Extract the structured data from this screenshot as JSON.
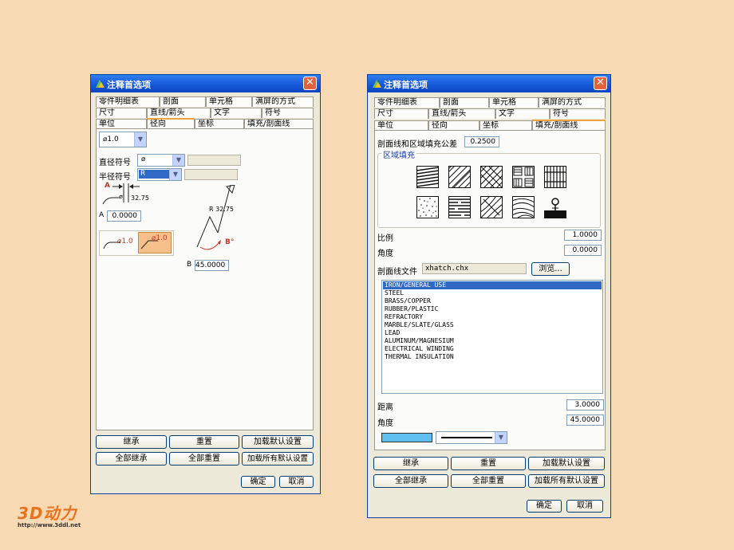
{
  "dialog_title": "注释首选项",
  "left": {
    "tabs_row1": [
      "零件明细表",
      "剖面",
      "单元格",
      "满屏的方式"
    ],
    "tabs_row2": [
      "尺寸",
      "直线/箭头",
      "文字",
      "符号"
    ],
    "tabs_row3": [
      "单位",
      "径向",
      "坐标",
      "填充/剖面线"
    ],
    "active_tab": "径向",
    "format_combo": "⌀1.0",
    "diameter_label": "直径符号",
    "diameter_value": "⌀",
    "radius_label": "半径符号",
    "radius_value": "R",
    "diag_a": "A",
    "diag_dia": "⌀",
    "diag_dim": "32.75",
    "diag_r_dim": "R 32.75",
    "diag_b": "B°",
    "a_label": "A",
    "a_value": "0.0000",
    "style1": "⌀1.0",
    "style2": "⌀1.0",
    "b_label": "B",
    "b_value": "45.0000",
    "btn_inherit": "继承",
    "btn_reset": "重置",
    "btn_load_default": "加载默认设置",
    "btn_inherit_all": "全部继承",
    "btn_reset_all": "全部重置",
    "btn_load_all_default": "加载所有默认设置",
    "btn_ok": "确定",
    "btn_cancel": "取消"
  },
  "right": {
    "tabs_row1": [
      "零件明细表",
      "剖面",
      "单元格",
      "满屏的方式"
    ],
    "tabs_row2": [
      "尺寸",
      "直线/箭头",
      "文字",
      "符号"
    ],
    "tabs_row3": [
      "单位",
      "径向",
      "坐标",
      "填充/剖面线"
    ],
    "active_tab": "填充/剖面线",
    "tolerance_label": "剖面线和区域填充公差",
    "tolerance_value": "0.2500",
    "group_label": "区域填充",
    "scale_label": "比例",
    "scale_value": "1.0000",
    "angle_label": "角度",
    "angle_value": "0.0000",
    "file_label": "剖面线文件",
    "file_value": "xhatch.chx",
    "browse": "浏览...",
    "materials": [
      "IRON/GENERAL USE",
      "STEEL",
      "BRASS/COPPER",
      "RUBBER/PLASTIC",
      "REFRACTORY",
      "MARBLE/SLATE/GLASS",
      "LEAD",
      "ALUMINUM/MAGNESIUM",
      "ELECTRICAL WINDING",
      "THERMAL INSULATION"
    ],
    "distance_label": "距离",
    "distance_value": "3.0000",
    "angle2_label": "角度",
    "angle2_value": "45.0000",
    "color_swatch": "#5fc0f0",
    "btn_inherit": "继承",
    "btn_reset": "重置",
    "btn_load_default": "加载默认设置",
    "btn_inherit_all": "全部继承",
    "btn_reset_all": "全部重置",
    "btn_load_all_default": "加载所有默认设置",
    "btn_ok": "确定",
    "btn_cancel": "取消"
  },
  "logo_text": "3D动力",
  "logo_url": "http://www.3ddl.net",
  "colors": {
    "title_bar": "#1556d6",
    "background": "#f7d9b4",
    "selection": "#316ac5",
    "dim_arrow": "#c0392b"
  }
}
